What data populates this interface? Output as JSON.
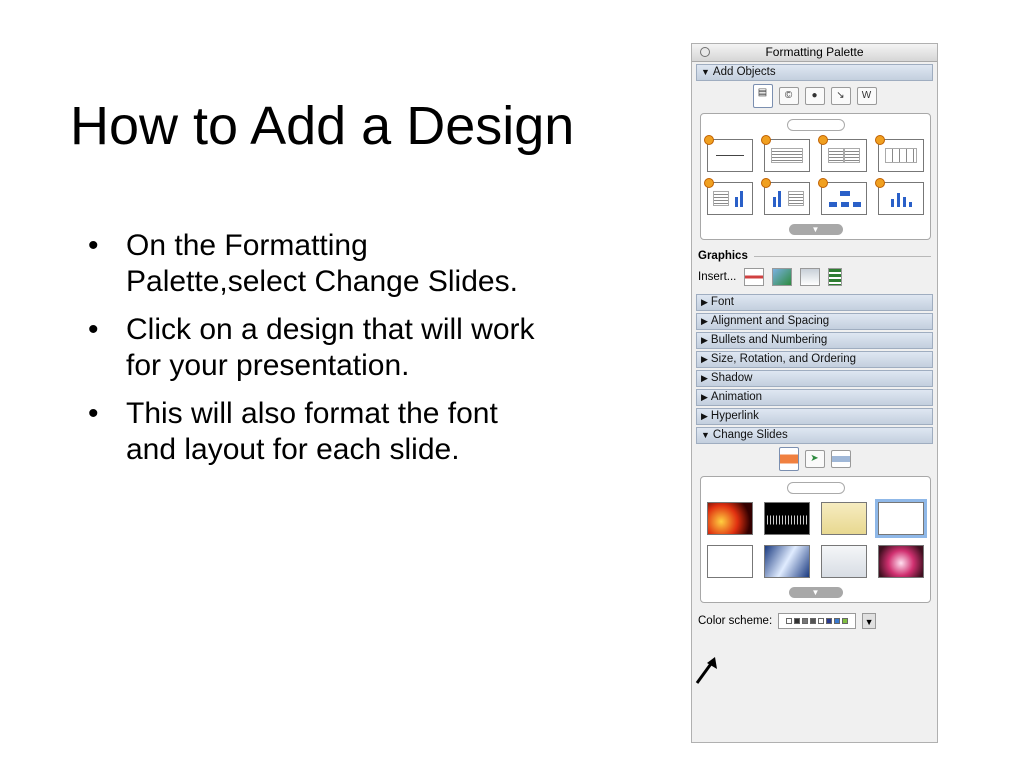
{
  "slide": {
    "title": "How to Add a Design",
    "bullets": [
      "On the Formatting Palette,select Change Slides.",
      "Click on a design that will work for your presentation.",
      "This will also format the font and layout for each slide."
    ],
    "bullet_char": "•"
  },
  "palette": {
    "title": "Formatting Palette",
    "add_objects": {
      "label": "Add Objects",
      "arrow": "▼"
    },
    "graphics": {
      "label": "Graphics",
      "insert_label": "Insert..."
    },
    "sections": [
      {
        "label": "Font",
        "arrow": "▶"
      },
      {
        "label": "Alignment and Spacing",
        "arrow": "▶"
      },
      {
        "label": "Bullets and Numbering",
        "arrow": "▶"
      },
      {
        "label": "Size, Rotation, and Ordering",
        "arrow": "▶"
      },
      {
        "label": "Shadow",
        "arrow": "▶"
      },
      {
        "label": "Animation",
        "arrow": "▶"
      },
      {
        "label": "Hyperlink",
        "arrow": "▶"
      }
    ],
    "change_slides": {
      "label": "Change Slides",
      "arrow": "▼"
    },
    "color_scheme": {
      "label": "Color scheme:"
    },
    "scroll_glyph": "▼",
    "colors": {
      "section_fill": "#c3cfde",
      "selected_outline": "#8fb8e8",
      "layout_accent": "#2a60c8",
      "plus_badge": "#f0a020"
    }
  }
}
